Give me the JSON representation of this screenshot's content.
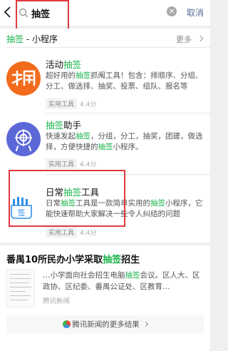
{
  "search": {
    "query": "抽签",
    "cancel_label": "取消"
  },
  "section": {
    "title_keyword": "抽签",
    "title_suffix": " - 小程序",
    "more_label": "更多"
  },
  "apps": [
    {
      "name_before": "活动",
      "name_keyword": "抽签",
      "name_after": "",
      "desc_parts": [
        "超好用的",
        "抽签",
        "抓阄工具！包含：排顺序、分组、分工、做选择、抽奖、投票、组队、报名等"
      ],
      "tag": "实用工具",
      "rating": "4.4分"
    },
    {
      "name_before": "",
      "name_keyword": "抽签",
      "name_after": "助手",
      "desc_parts": [
        "快速发起",
        "抽签",
        "，分组，分工，抽奖，团建，做选择，方便快捷的",
        "抽签",
        "小程序。"
      ],
      "tag": "实用工具",
      "rating": "4.4分"
    },
    {
      "name_before": "日常",
      "name_keyword": "抽签",
      "name_after": "工具",
      "desc_parts": [
        "日常",
        "抽签",
        "工具是一款简单实用的",
        "抽签",
        "小程序，它能快速帮助大家解决一些令人纠结的问题"
      ],
      "tag": "实用工具",
      "rating": "4.4分",
      "icon_text": "签"
    }
  ],
  "news": {
    "title_before": "番禺10所民办小学采取",
    "title_keyword": "抽签",
    "title_after": "招生",
    "desc_parts": [
      "…小学面向社会招生电脑",
      "抽签",
      "会议。区人大、区政协、区纪委、番禺公证处、区教育…"
    ],
    "source": "腾讯新闻",
    "more_label": "腾讯新闻的更多结果"
  },
  "colors": {
    "highlight": "#19b34a",
    "annotation_box": "#e0383e",
    "link": "#576b95"
  }
}
